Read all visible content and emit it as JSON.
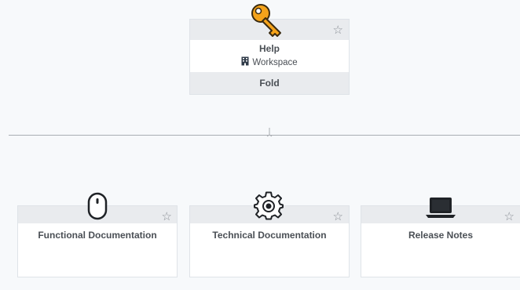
{
  "parent_card": {
    "title": "Help",
    "subtitle": "Workspace",
    "fold_label": "Fold",
    "icon": "key-icon",
    "starred": false
  },
  "children": [
    {
      "title": "Functional Documentation",
      "icon": "mouse-icon",
      "starred": false
    },
    {
      "title": "Technical Documentation",
      "icon": "gear-icon",
      "starred": false
    },
    {
      "title": "Release Notes",
      "icon": "laptop-icon",
      "starred": false
    }
  ],
  "colors": {
    "key_icon": "#f5a31a",
    "band": "#e9ebee",
    "border": "#dfe3e8",
    "connector": "#a9adb2"
  }
}
